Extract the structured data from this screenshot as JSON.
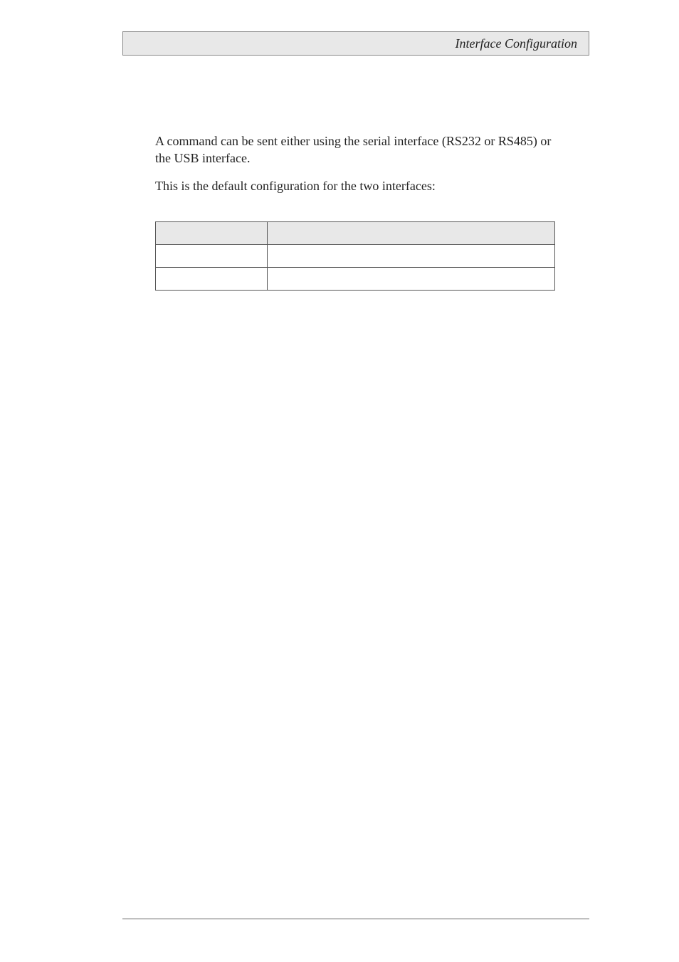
{
  "header": {
    "title": "Interface Configuration"
  },
  "body": {
    "para1": "A command can be sent either using the serial interface (RS232 or RS485) or the USB interface.",
    "para2": "This is the default configuration for the two interfaces:"
  },
  "table": {
    "headers": [
      "",
      ""
    ],
    "rows": [
      [
        "",
        ""
      ],
      [
        "",
        ""
      ]
    ]
  }
}
